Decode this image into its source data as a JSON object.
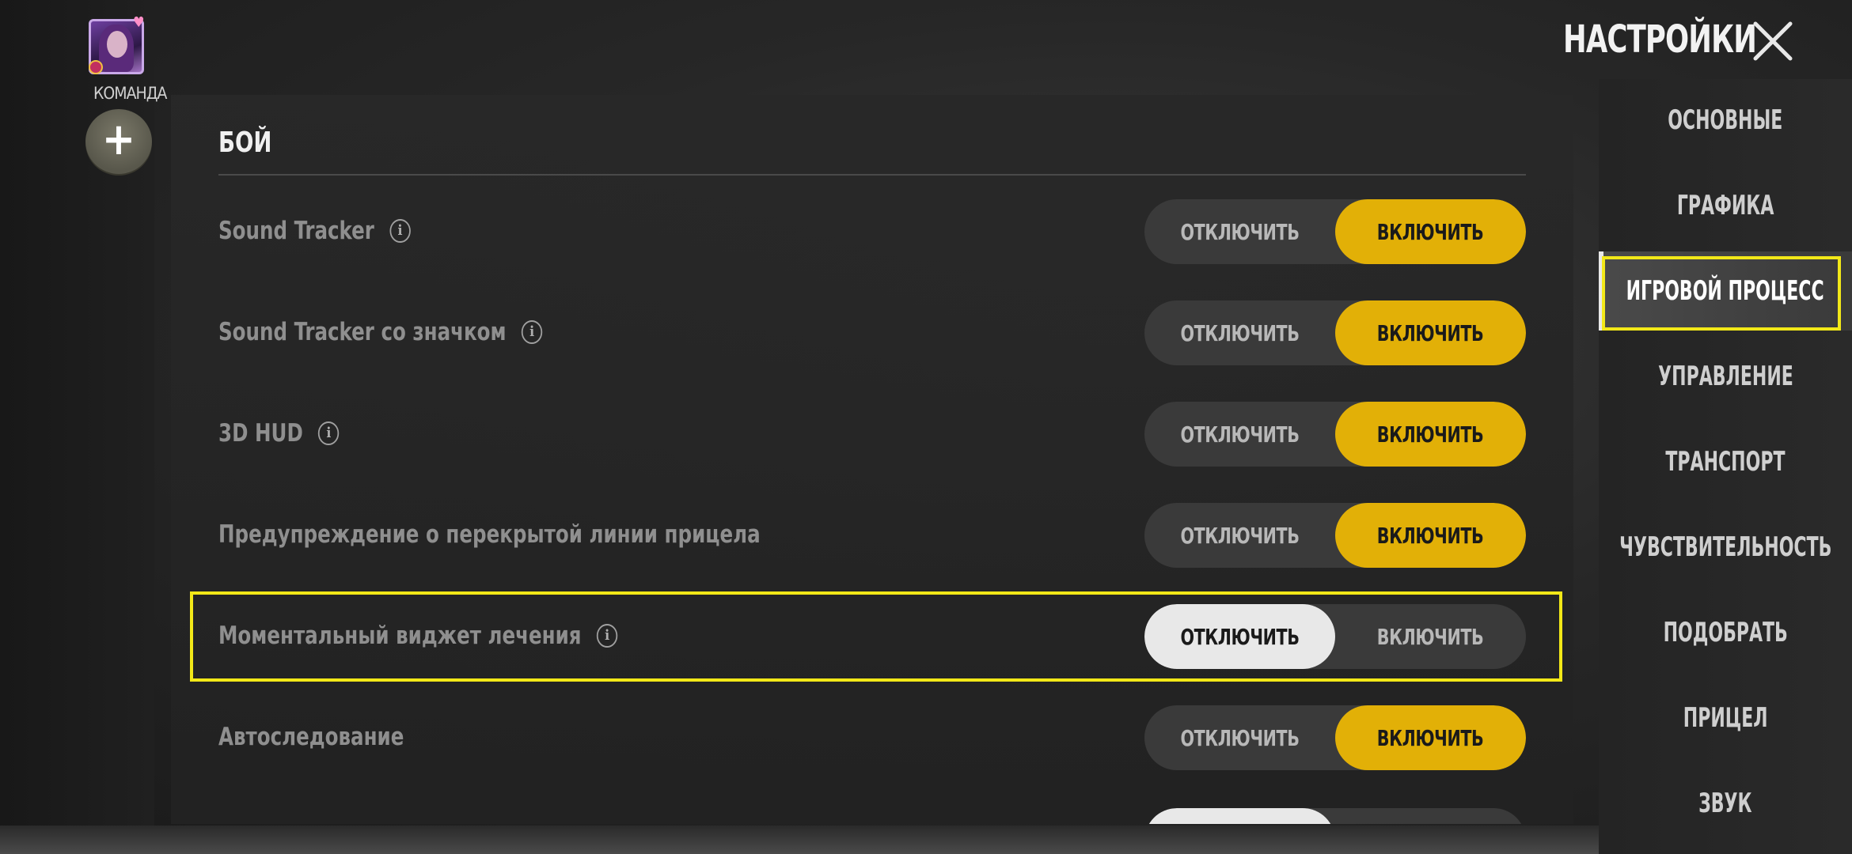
{
  "header": {
    "title": "НАСТРОЙКИ"
  },
  "team": {
    "label": "КОМАНДА",
    "add_symbol": "+"
  },
  "section": {
    "title": "БОЙ"
  },
  "toggle_labels": {
    "off": "ОТКЛЮЧИТЬ",
    "on": "ВКЛЮЧИТЬ"
  },
  "settings": [
    {
      "label": "Sound Tracker",
      "has_info": true,
      "state": "on"
    },
    {
      "label": "Sound Tracker со значком",
      "has_info": true,
      "state": "on"
    },
    {
      "label": "3D HUD",
      "has_info": true,
      "state": "on"
    },
    {
      "label": "Предупреждение о перекрытой линии прицела",
      "has_info": false,
      "state": "on"
    },
    {
      "label": "Моментальный виджет лечения",
      "has_info": true,
      "state": "off",
      "highlighted": true
    },
    {
      "label": "Автоследование",
      "has_info": false,
      "state": "on"
    }
  ],
  "sidebar": {
    "items": [
      {
        "label": "ОСНОВНЫЕ"
      },
      {
        "label": "ГРАФИКА"
      },
      {
        "label": "ИГРОВОЙ ПРОЦЕСС",
        "active": true
      },
      {
        "label": "УПРАВЛЕНИЕ"
      },
      {
        "label": "ТРАНСПОРТ"
      },
      {
        "label": "ЧУВСТВИТЕЛЬНОСТЬ"
      },
      {
        "label": "ПОДОБРАТЬ"
      },
      {
        "label": "ПРИЦЕЛ"
      },
      {
        "label": "ЗВУК"
      }
    ]
  },
  "colors": {
    "accent_on": "#e2b007",
    "accent_off": "#e8e8e8",
    "highlight": "#f2e818"
  },
  "icons": {
    "close": "close-icon",
    "info": "info-icon",
    "add": "plus-icon"
  }
}
